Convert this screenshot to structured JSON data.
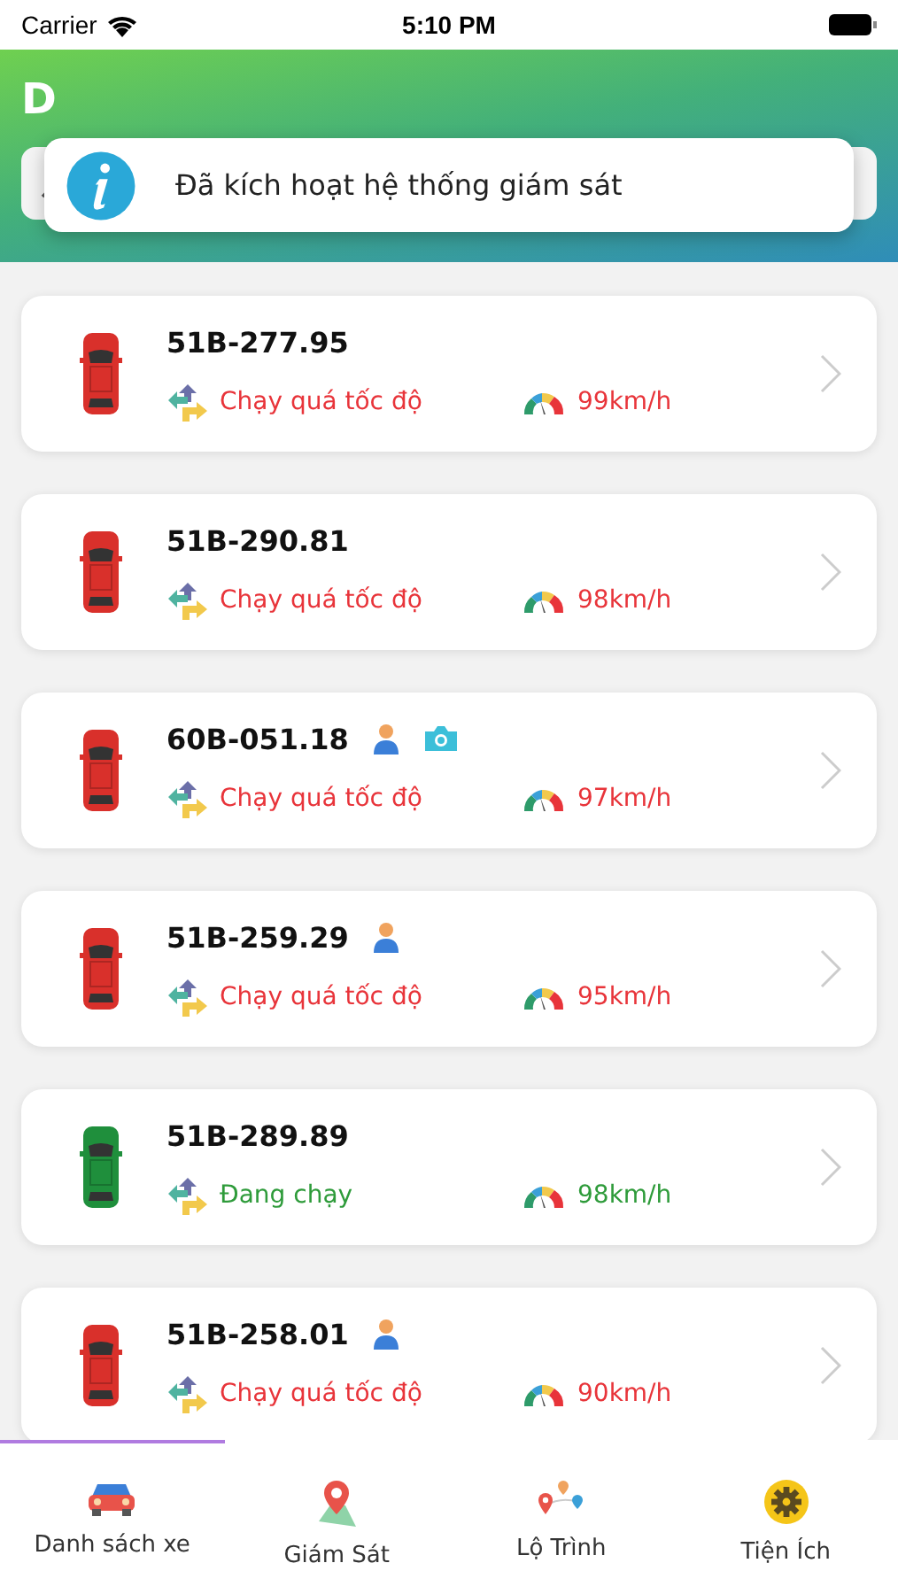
{
  "status_bar": {
    "carrier": "Carrier",
    "time": "5:10 PM"
  },
  "header": {
    "title": "D"
  },
  "toast": {
    "message": "Đã kích hoạt hệ thống giám sát"
  },
  "vehicles": [
    {
      "plate": "51B-277.95",
      "driver": false,
      "camera": false,
      "status": {
        "kind": "overspeed",
        "label": "Chạy quá tốc độ"
      },
      "speed": "99km/h"
    },
    {
      "plate": "51B-290.81",
      "driver": false,
      "camera": false,
      "status": {
        "kind": "overspeed",
        "label": "Chạy quá tốc độ"
      },
      "speed": "98km/h"
    },
    {
      "plate": "60B-051.18",
      "driver": true,
      "camera": true,
      "status": {
        "kind": "overspeed",
        "label": "Chạy quá tốc độ"
      },
      "speed": "97km/h"
    },
    {
      "plate": "51B-259.29",
      "driver": true,
      "camera": false,
      "status": {
        "kind": "overspeed",
        "label": "Chạy quá tốc độ"
      },
      "speed": "95km/h"
    },
    {
      "plate": "51B-289.89",
      "driver": false,
      "camera": false,
      "status": {
        "kind": "running",
        "label": "Đang chạy"
      },
      "speed": "98km/h"
    },
    {
      "plate": "51B-258.01",
      "driver": true,
      "camera": false,
      "status": {
        "kind": "overspeed",
        "label": "Chạy quá tốc độ"
      },
      "speed": "90km/h"
    }
  ],
  "tabs": [
    {
      "label": "Danh sách xe",
      "selected": true
    },
    {
      "label": "Giám Sát",
      "selected": false
    },
    {
      "label": "Lộ Trình",
      "selected": false
    },
    {
      "label": "Tiện Ích",
      "selected": false
    }
  ]
}
